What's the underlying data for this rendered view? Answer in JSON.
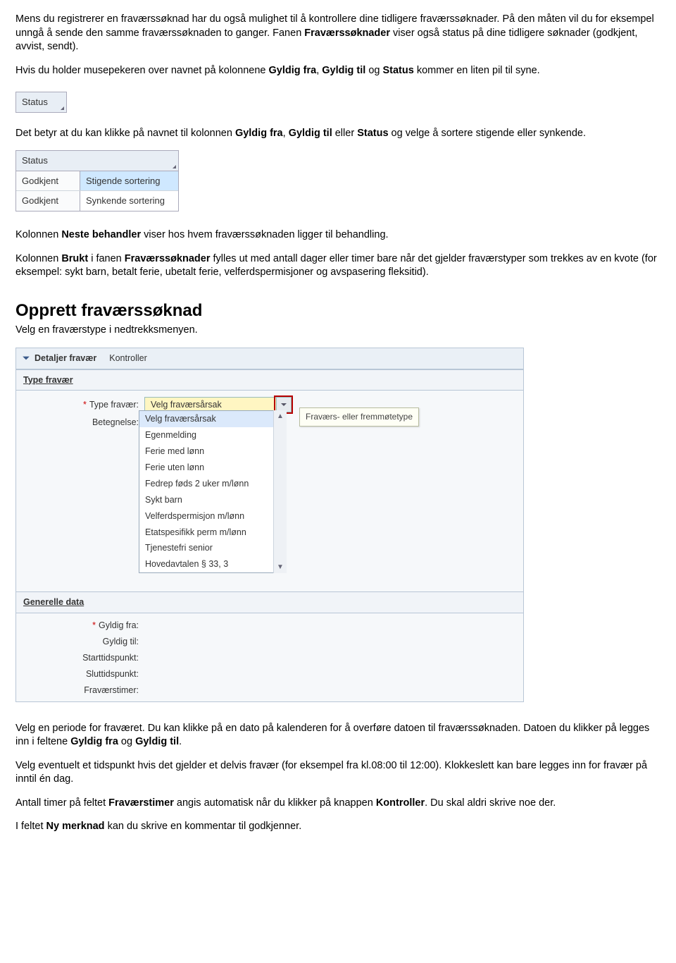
{
  "p1_a": "Mens du registrerer en fraværssøknad har du også mulighet til å kontrollere dine tidligere fraværssøknader. På den måten vil du for eksempel unngå å sende den samme fraværssøknaden to ganger. Fanen ",
  "p1_b": "Fraværssøknader",
  "p1_c": " viser også status på dine tidligere søknader (godkjent, avvist, sendt).",
  "p2_a": "Hvis du holder musepekeren over navnet på kolonnene ",
  "p2_b": "Gyldig fra",
  "p2_c": ", ",
  "p2_d": "Gyldig til",
  "p2_e": " og ",
  "p2_f": "Status",
  "p2_g": " kommer en liten pil til syne.",
  "fig1_label": "Status",
  "p3_a": "Det betyr at du kan klikke på navnet til kolonnen ",
  "p3_b": "Gyldig fra",
  "p3_c": ", ",
  "p3_d": "Gyldig til",
  "p3_e": " eller ",
  "p3_f": "Status",
  "p3_g": " og velge å sortere stigende eller synkende.",
  "fig2": {
    "header": "Status",
    "rows": [
      {
        "left": "Godkjent",
        "right": "Stigende sortering"
      },
      {
        "left": "Godkjent",
        "right": "Synkende sortering"
      }
    ]
  },
  "p4_a": "Kolonnen ",
  "p4_b": "Neste behandler",
  "p4_c": " viser hos hvem fraværssøknaden ligger til behandling.",
  "p5_a": "Kolonnen ",
  "p5_b": "Brukt",
  "p5_c": " i fanen ",
  "p5_d": "Fraværssøknader",
  "p5_e": " fylles ut med antall dager eller timer bare når det gjelder fraværstyper som trekkes av en kvote (for eksempel: sykt barn, betalt ferie, ubetalt ferie, velferdspermisjoner og avspasering fleksitid).",
  "h2": "Opprett fraværssøknad",
  "p6": "Velg en fraværstype i nedtrekksmenyen.",
  "fig3": {
    "toolbar_collapse": "Detaljer fravær",
    "toolbar_btn": "Kontroller",
    "section1": "Type fravær",
    "label_type": "Type fravær:",
    "label_bet": "Betegnelse:",
    "combo_value": "Velg fraværsårsak",
    "tooltip": "Fraværs- eller fremmøtetype",
    "options": [
      "Velg fraværsårsak",
      "Egenmelding",
      "Ferie med lønn",
      "Ferie uten lønn",
      "Fedrep føds 2 uker m/lønn",
      "Sykt barn",
      "Velferdspermisjon m/lønn",
      "Etatspesifikk perm m/lønn",
      "Tjenestefri senior",
      "Hovedavtalen § 33, 3"
    ],
    "section2": "Generelle data",
    "label_gfra": "Gyldig fra:",
    "label_gtil": "Gyldig til:",
    "label_start": "Starttidspunkt:",
    "label_slutt": "Sluttidspunkt:",
    "label_timer": "Fraværstimer:"
  },
  "p7_a": "Velg en periode for fraværet. Du kan klikke på en dato på kalenderen for å overføre datoen til fraværssøknaden. Datoen du klikker på legges inn i feltene ",
  "p7_b": "Gyldig fra",
  "p7_c": " og ",
  "p7_d": "Gyldig til",
  "p7_e": ".",
  "p8": "Velg eventuelt et tidspunkt hvis det gjelder et delvis fravær (for eksempel fra kl.08:00 til 12:00). Klokkeslett kan bare legges inn for fravær på inntil én dag.",
  "p9_a": "Antall timer på feltet ",
  "p9_b": "Fraværstimer",
  "p9_c": " angis automatisk når du klikker på knappen ",
  "p9_d": "Kontroller",
  "p9_e": ". Du skal aldri skrive noe der.",
  "p10_a": "I feltet ",
  "p10_b": "Ny merknad",
  "p10_c": " kan du skrive en kommentar til godkjenner."
}
